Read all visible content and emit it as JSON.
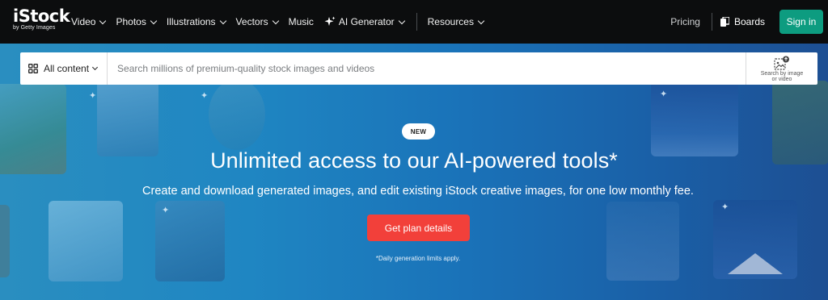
{
  "brand": {
    "name": "iStock",
    "tagline": "by Getty Images"
  },
  "nav": {
    "items": [
      {
        "label": "Video",
        "dropdown": true
      },
      {
        "label": "Photos",
        "dropdown": true
      },
      {
        "label": "Illustrations",
        "dropdown": true
      },
      {
        "label": "Vectors",
        "dropdown": true
      },
      {
        "label": "Music",
        "dropdown": false
      },
      {
        "label": "AI Generator",
        "dropdown": true,
        "icon": "sparkle-icon"
      }
    ],
    "resources_label": "Resources",
    "pricing_label": "Pricing",
    "boards_label": "Boards",
    "signin_label": "Sign in"
  },
  "search": {
    "filter_label": "All content",
    "placeholder": "Search millions of premium-quality stock images and videos",
    "value": "",
    "image_search_label": "Search by image or video"
  },
  "hero": {
    "badge": "NEW",
    "headline": "Unlimited access to our AI-powered tools*",
    "subline": "Create and download generated images, and edit existing iStock creative images, for one low monthly fee.",
    "cta_label": "Get plan details",
    "disclaimer": "*Daily generation limits apply."
  },
  "colors": {
    "nav_bg": "#0c0d0e",
    "signin_bg": "#0d9c80",
    "cta_bg": "#f2403a",
    "hero_blue": "#1f86c2"
  }
}
